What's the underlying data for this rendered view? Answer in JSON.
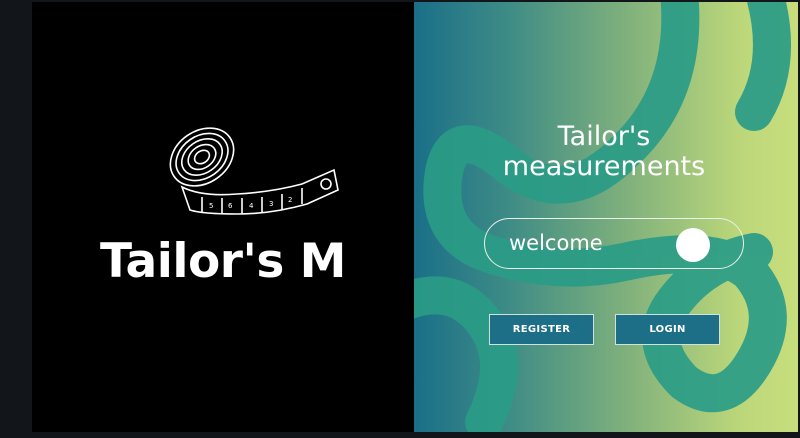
{
  "brand": {
    "name": "Tailor's M",
    "logo_icon": "measuring-tape-icon"
  },
  "panel": {
    "title": "Tailor's measurements",
    "toggle_label": "welcome",
    "toggle_state": "on",
    "register_label": "REGISTER",
    "login_label": "LOGIN"
  },
  "colors": {
    "left_bg": "#000000",
    "gradient_start": "#1a6f88",
    "gradient_end": "#c8de7d",
    "swirl": "#2a9c86",
    "button_bg": "#1d6f88"
  }
}
